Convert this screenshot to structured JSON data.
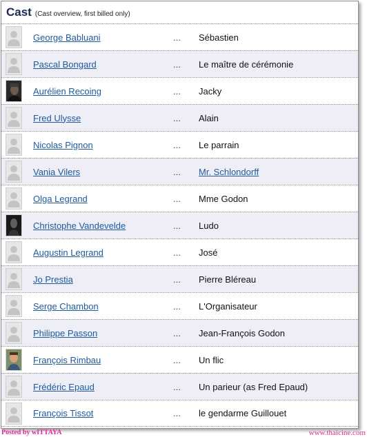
{
  "header": {
    "title": "Cast",
    "subtitle": "(Cast overview, first billed only)"
  },
  "separator": "...",
  "cast": [
    {
      "actor": "George Babluani",
      "role": "Sébastien",
      "photo": "placeholder-icon",
      "role_is_link": false
    },
    {
      "actor": "Pascal Bongard",
      "role": "Le maître de cérémonie",
      "photo": "placeholder-icon",
      "role_is_link": false
    },
    {
      "actor": "Aurélien Recoing",
      "role": "Jacky",
      "photo": "headshot-photo",
      "role_is_link": false
    },
    {
      "actor": "Fred Ulysse",
      "role": "Alain",
      "photo": "placeholder-icon",
      "role_is_link": false
    },
    {
      "actor": "Nicolas Pignon",
      "role": "Le parrain",
      "photo": "placeholder-icon",
      "role_is_link": false
    },
    {
      "actor": "Vania Vilers",
      "role": "Mr. Schlondorff",
      "photo": "placeholder-icon",
      "role_is_link": true
    },
    {
      "actor": "Olga Legrand",
      "role": "Mme Godon",
      "photo": "placeholder-icon",
      "role_is_link": false
    },
    {
      "actor": "Christophe Vandevelde",
      "role": "Ludo",
      "photo": "headshot-photo",
      "role_is_link": false
    },
    {
      "actor": "Augustin Legrand",
      "role": "José",
      "photo": "placeholder-icon",
      "role_is_link": false
    },
    {
      "actor": "Jo Prestia",
      "role": "Pierre Bléreau",
      "photo": "placeholder-icon",
      "role_is_link": false
    },
    {
      "actor": "Serge Chambon",
      "role": "L'Organisateur",
      "photo": "placeholder-icon",
      "role_is_link": false
    },
    {
      "actor": "Philippe Passon",
      "role": "Jean-François Godon",
      "photo": "placeholder-icon",
      "role_is_link": false
    },
    {
      "actor": "François Rimbau",
      "role": "Un flic",
      "photo": "headshot-photo",
      "role_is_link": false
    },
    {
      "actor": "Frédéric Epaud",
      "role": "Un parieur (as Fred Epaud)",
      "photo": "placeholder-icon",
      "role_is_link": false
    },
    {
      "actor": "François Tissot",
      "role": "le gendarme Guillouet",
      "photo": "placeholder-icon",
      "role_is_link": false
    }
  ],
  "footer": {
    "left": "Posted by wITTAYA",
    "right": "www.thaicine.com"
  },
  "colors": {
    "link": "#1d5a9c",
    "alt_row": "#eeeef6",
    "title": "#1a2b5a",
    "watermark": "#e0289a"
  }
}
